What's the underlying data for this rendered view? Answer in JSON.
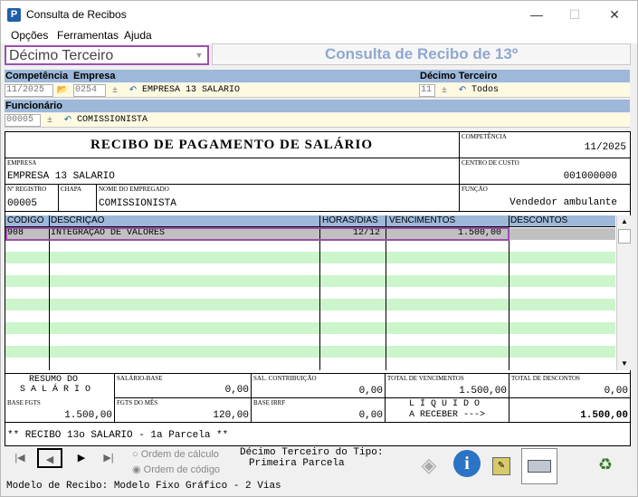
{
  "window": {
    "title": "Consulta de Recibos",
    "minimize": "—",
    "maximize": "☐",
    "close": "✕",
    "app_letter": "P"
  },
  "menu": [
    "Opções",
    "Ferramentas",
    "Ajuda"
  ],
  "type_select": {
    "value": "Décimo Terceiro"
  },
  "header_title": "Consulta de Recibo de 13º",
  "filters": {
    "competencia_label": "Competência",
    "empresa_label": "Empresa",
    "decimo_label": "Décimo Terceiro",
    "funcionario_label": "Funcionário",
    "competencia": "11/2025",
    "empresa_code": "0254",
    "empresa_name": "EMPRESA 13 SALARIO",
    "decimo_code": "11",
    "decimo_name": "Todos",
    "func_code": "00005",
    "func_name": "COMISSIONISTA"
  },
  "receipt": {
    "title": "RECIBO DE PAGAMENTO DE SALÁRIO",
    "competencia_label": "COMPETÊNCIA",
    "competencia": "11/2025",
    "empresa_label": "EMPRESA",
    "empresa": "EMPRESA 13 SALARIO",
    "centro_label": "CENTRO DE CUSTO",
    "centro": "001000000",
    "registro_label": "Nº REGISTRO",
    "registro": "00005",
    "chapa_label": "CHAPA",
    "nome_label": "NOME DO EMPREGADO",
    "nome": "COMISSIONISTA",
    "funcao_label": "FUNÇÃO",
    "funcao": "Vendedor ambulante"
  },
  "table": {
    "headers": {
      "codigo": "CÓDIGO",
      "descricao": "DESCRIÇÃO",
      "horas": "HORAS/DIAS",
      "vencimentos": "VENCIMENTOS",
      "descontos": "DESCONTOS"
    },
    "rows": [
      {
        "codigo": "908",
        "descricao": "INTEGRAÇÃO DE VALORES",
        "horas": "12/12",
        "vencimentos": "1.500,00",
        "descontos": ""
      }
    ]
  },
  "summary": {
    "resumo_1": "RESUMO DO",
    "resumo_2": "S A L Á R I O",
    "salario_base_label": "SALÁRIO-BASE",
    "salario_base": "0,00",
    "sal_contrib_label": "SAL. CONTRIBUIÇÃO",
    "sal_contrib": "0,00",
    "total_venc_label": "TOTAL DE VENCIMENTOS",
    "total_venc": "1.500,00",
    "total_desc_label": "TOTAL DE DESCONTOS",
    "total_desc": "0,00",
    "base_fgts_label": "BASE FGTS",
    "base_fgts": "1.500,00",
    "fgts_mes_label": "FGTS DO MÊS",
    "fgts_mes": "120,00",
    "base_irrf_label": "BASE IRRF",
    "base_irrf": "0,00",
    "liquido_1": "L Í Q U I D O",
    "liquido_2": "A RECEBER --->",
    "liquido": "1.500,00",
    "note": "** RECIBO 13o SALARIO - 1a Parcela **"
  },
  "bottom": {
    "radio_calc": "Ordem de cálculo",
    "radio_code": "Ordem de código",
    "tipo_1": "Décimo Terceiro do Tipo:",
    "tipo_2": "Primeira Parcela",
    "status": "Modelo de Recibo: Modelo Fixo Gráfico - 2 Vias"
  }
}
